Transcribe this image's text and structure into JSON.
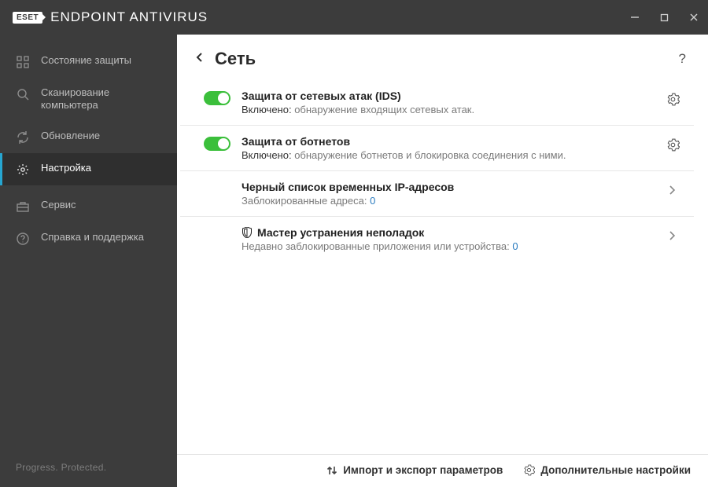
{
  "app": {
    "logo_text": "ESET",
    "title": "ENDPOINT ANTIVIRUS"
  },
  "sidebar": {
    "items": [
      {
        "label": "Состояние защиты"
      },
      {
        "label": "Сканирование компьютера"
      },
      {
        "label": "Обновление"
      },
      {
        "label": "Настройка"
      },
      {
        "label": "Сервис"
      },
      {
        "label": "Справка и поддержка"
      }
    ],
    "footer": "Progress. Protected."
  },
  "page": {
    "title": "Сеть",
    "help_glyph": "?"
  },
  "rows": {
    "ids": {
      "title": "Защита от сетевых атак (IDS)",
      "status_label": "Включено:",
      "status_desc": "обнаружение входящих сетевых атак."
    },
    "botnet": {
      "title": "Защита от ботнетов",
      "status_label": "Включено:",
      "status_desc": "обнаружение ботнетов и блокировка соединения с ними."
    },
    "blacklist": {
      "title": "Черный список временных IP-адресов",
      "sub_label": "Заблокированные адреса:",
      "count": "0"
    },
    "troubleshoot": {
      "title": "Мастер устранения неполадок",
      "sub_label": "Недавно заблокированные приложения или устройства:",
      "count": "0"
    }
  },
  "bottombar": {
    "import_export": "Импорт и экспорт параметров",
    "advanced": "Дополнительные настройки"
  }
}
